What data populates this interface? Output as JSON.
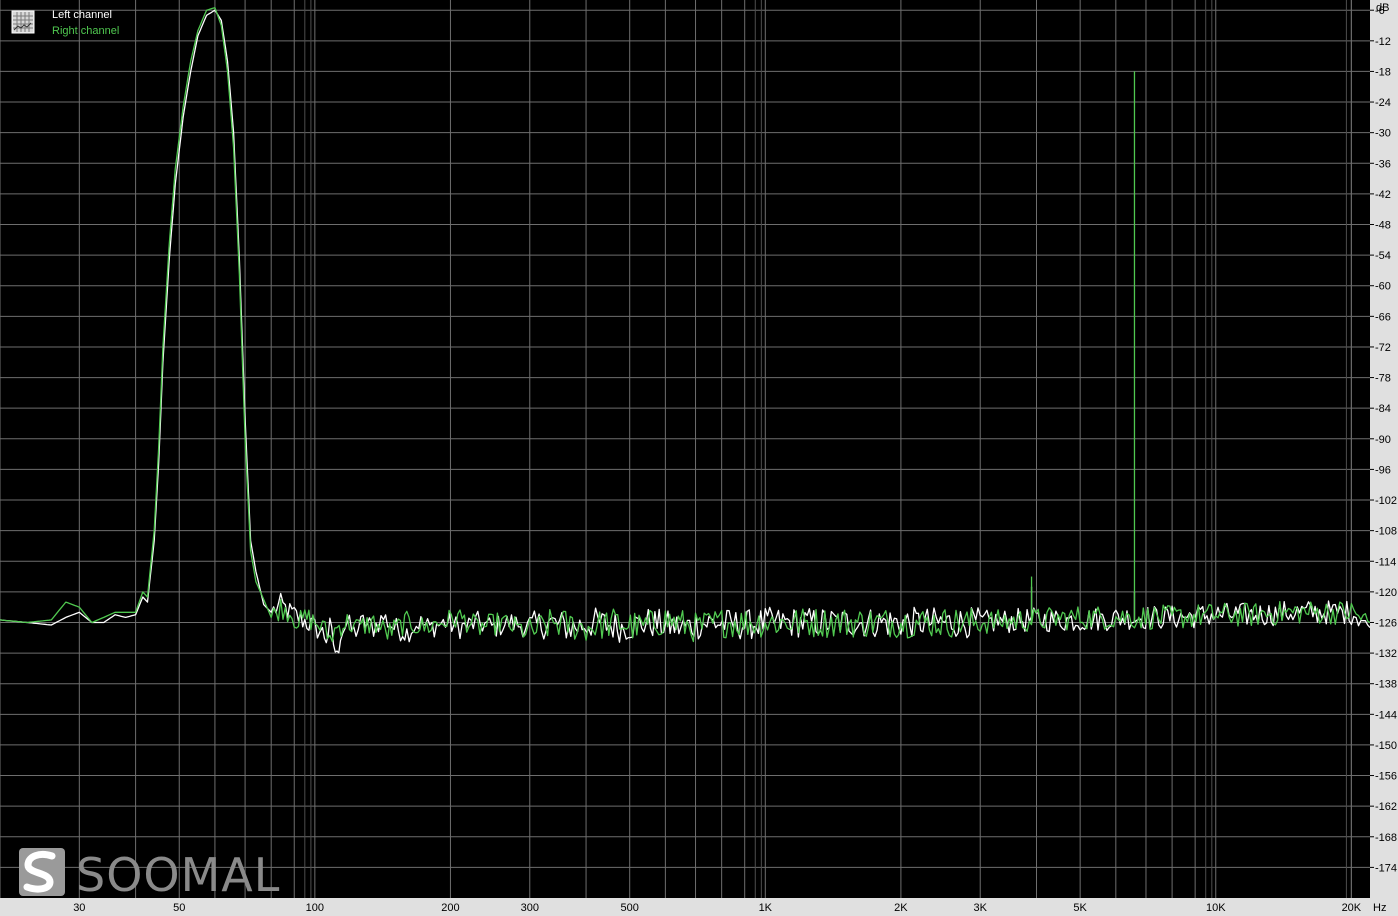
{
  "chart_data": {
    "type": "line",
    "x_unit": "Hz",
    "y_unit": "dB",
    "x_scale": "log",
    "xlim": [
      20,
      22000
    ],
    "ylim": [
      -180,
      -4
    ],
    "grid": true,
    "legend_placement": "top-left",
    "x_ticks": [
      {
        "value": 30,
        "label": "30"
      },
      {
        "value": 50,
        "label": "50"
      },
      {
        "value": 100,
        "label": "100"
      },
      {
        "value": 200,
        "label": "200"
      },
      {
        "value": 300,
        "label": "300"
      },
      {
        "value": 500,
        "label": "500"
      },
      {
        "value": 1000,
        "label": "1K"
      },
      {
        "value": 2000,
        "label": "2K"
      },
      {
        "value": 3000,
        "label": "3K"
      },
      {
        "value": 5000,
        "label": "5K"
      },
      {
        "value": 10000,
        "label": "10K"
      },
      {
        "value": 20000,
        "label": "20K"
      }
    ],
    "y_ticks": [
      {
        "value": -6,
        "label": "-6"
      },
      {
        "value": -12,
        "label": "-12"
      },
      {
        "value": -18,
        "label": "-18"
      },
      {
        "value": -24,
        "label": "-24"
      },
      {
        "value": -30,
        "label": "-30"
      },
      {
        "value": -36,
        "label": "-36"
      },
      {
        "value": -42,
        "label": "-42"
      },
      {
        "value": -48,
        "label": "-48"
      },
      {
        "value": -54,
        "label": "-54"
      },
      {
        "value": -60,
        "label": "-60"
      },
      {
        "value": -66,
        "label": "-66"
      },
      {
        "value": -72,
        "label": "-72"
      },
      {
        "value": -78,
        "label": "-78"
      },
      {
        "value": -84,
        "label": "-84"
      },
      {
        "value": -90,
        "label": "-90"
      },
      {
        "value": -96,
        "label": "-96"
      },
      {
        "value": -102,
        "label": "-102"
      },
      {
        "value": -108,
        "label": "-108"
      },
      {
        "value": -114,
        "label": "-114"
      },
      {
        "value": -120,
        "label": "-120"
      },
      {
        "value": -126,
        "label": "-126"
      },
      {
        "value": -132,
        "label": "-132"
      },
      {
        "value": -138,
        "label": "-138"
      },
      {
        "value": -144,
        "label": "-144"
      },
      {
        "value": -150,
        "label": "-150"
      },
      {
        "value": -156,
        "label": "-156"
      },
      {
        "value": -162,
        "label": "-162"
      },
      {
        "value": -168,
        "label": "-168"
      },
      {
        "value": -174,
        "label": "-174"
      }
    ],
    "series": [
      {
        "name": "Left channel",
        "color": "#ffffff",
        "points": [
          [
            20,
            -125.5
          ],
          [
            23,
            -126
          ],
          [
            26,
            -126.5
          ],
          [
            28,
            -125
          ],
          [
            30,
            -124
          ],
          [
            32,
            -126
          ],
          [
            34,
            -126
          ],
          [
            36,
            -124.5
          ],
          [
            38,
            -125
          ],
          [
            40,
            -124.5
          ],
          [
            41.5,
            -121
          ],
          [
            42.5,
            -122
          ],
          [
            44,
            -110
          ],
          [
            45,
            -95
          ],
          [
            46,
            -75
          ],
          [
            47.5,
            -55
          ],
          [
            49,
            -40
          ],
          [
            51,
            -27
          ],
          [
            53,
            -18
          ],
          [
            55,
            -11
          ],
          [
            57.5,
            -7
          ],
          [
            60,
            -6
          ],
          [
            62,
            -8
          ],
          [
            64,
            -16
          ],
          [
            66,
            -30
          ],
          [
            68,
            -55
          ],
          [
            70,
            -86
          ],
          [
            72,
            -110
          ],
          [
            74,
            -116
          ],
          [
            77,
            -122.5
          ],
          [
            80,
            -124
          ],
          [
            84,
            -122.5
          ],
          [
            88,
            -124
          ],
          [
            92,
            -125
          ],
          [
            96,
            -126
          ],
          [
            100,
            -127
          ],
          [
            104,
            -128
          ],
          [
            106,
            -129
          ],
          [
            108,
            -127
          ],
          [
            110,
            -130
          ],
          [
            112,
            -133
          ],
          [
            114,
            -128
          ],
          [
            118,
            -126
          ],
          [
            122,
            -128
          ],
          [
            128,
            -126
          ],
          [
            135,
            -127
          ],
          [
            142,
            -125
          ],
          [
            150,
            -127
          ],
          [
            160,
            -128
          ],
          [
            170,
            -126
          ],
          [
            180,
            -127
          ],
          [
            195,
            -126
          ],
          [
            210,
            -127
          ],
          [
            230,
            -126
          ],
          [
            250,
            -127
          ],
          [
            270,
            -126
          ],
          [
            300,
            -127
          ],
          [
            330,
            -126
          ],
          [
            370,
            -127
          ],
          [
            420,
            -126
          ],
          [
            480,
            -127
          ],
          [
            550,
            -126
          ],
          [
            650,
            -127
          ],
          [
            750,
            -126
          ],
          [
            900,
            -126.5
          ],
          [
            1000,
            -126
          ],
          [
            1500,
            -126
          ],
          [
            2000,
            -126
          ],
          [
            3000,
            -126
          ],
          [
            3900,
            -125.5
          ],
          [
            5000,
            -125.5
          ],
          [
            6500,
            -125
          ],
          [
            6600,
            -125
          ],
          [
            8000,
            -125
          ],
          [
            10000,
            -124.5
          ],
          [
            12000,
            -124.5
          ],
          [
            15000,
            -124
          ],
          [
            18000,
            -124
          ],
          [
            20000,
            -124
          ],
          [
            21000,
            -125
          ],
          [
            22000,
            -127
          ]
        ],
        "spikes": [
          [
            3900,
            -119
          ],
          [
            6600,
            -120
          ]
        ]
      },
      {
        "name": "Right channel",
        "color": "#50c850",
        "points": [
          [
            20,
            -125.5
          ],
          [
            23,
            -126
          ],
          [
            26,
            -125.5
          ],
          [
            28,
            -122
          ],
          [
            30,
            -123
          ],
          [
            32,
            -126
          ],
          [
            34,
            -125
          ],
          [
            36,
            -124
          ],
          [
            38,
            -124
          ],
          [
            40,
            -124
          ],
          [
            41.5,
            -120
          ],
          [
            42.5,
            -121
          ],
          [
            44,
            -108
          ],
          [
            45,
            -92
          ],
          [
            46,
            -72
          ],
          [
            47.5,
            -52
          ],
          [
            49,
            -37
          ],
          [
            51,
            -25
          ],
          [
            53,
            -16
          ],
          [
            55,
            -10
          ],
          [
            57.5,
            -6
          ],
          [
            60,
            -5.5
          ],
          [
            62,
            -9
          ],
          [
            64,
            -18
          ],
          [
            66,
            -33
          ],
          [
            68,
            -58
          ],
          [
            70,
            -90
          ],
          [
            72,
            -112
          ],
          [
            74,
            -118
          ],
          [
            77,
            -121.5
          ],
          [
            80,
            -125
          ],
          [
            84,
            -123
          ],
          [
            88,
            -124
          ],
          [
            92,
            -126
          ],
          [
            96,
            -125
          ],
          [
            100,
            -126
          ],
          [
            104,
            -127
          ],
          [
            108,
            -129
          ],
          [
            112,
            -127
          ],
          [
            118,
            -126
          ],
          [
            125,
            -127
          ],
          [
            135,
            -126
          ],
          [
            145,
            -128
          ],
          [
            160,
            -126
          ],
          [
            175,
            -127
          ],
          [
            190,
            -126
          ],
          [
            210,
            -125
          ],
          [
            230,
            -127
          ],
          [
            260,
            -126
          ],
          [
            300,
            -128
          ],
          [
            340,
            -126
          ],
          [
            400,
            -127
          ],
          [
            460,
            -126
          ],
          [
            530,
            -127
          ],
          [
            600,
            -125.5
          ],
          [
            700,
            -127
          ],
          [
            800,
            -126
          ],
          [
            1000,
            -126
          ],
          [
            1500,
            -126
          ],
          [
            2000,
            -126
          ],
          [
            3000,
            -126
          ],
          [
            3900,
            -125.5
          ],
          [
            5000,
            -125
          ],
          [
            6500,
            -125
          ],
          [
            6600,
            -125
          ],
          [
            8000,
            -125
          ],
          [
            10000,
            -124.5
          ],
          [
            12000,
            -124.5
          ],
          [
            15000,
            -124
          ],
          [
            18000,
            -124
          ],
          [
            20000,
            -124
          ],
          [
            21000,
            -125
          ],
          [
            22000,
            -126
          ]
        ],
        "spikes": [
          [
            3900,
            -117
          ],
          [
            6600,
            -18
          ]
        ]
      }
    ]
  },
  "legend": {
    "icon": "spectrum-icon",
    "items": [
      {
        "label": "Left channel",
        "color": "#ffffff"
      },
      {
        "label": "Right channel",
        "color": "#50c850"
      }
    ]
  },
  "watermark": {
    "logo": "soomal-logo-icon",
    "text": "SOOMAL"
  },
  "colors": {
    "background": "#000000",
    "grid": "#6e6e6e",
    "axis_panel": "#e0e0e0",
    "tick_text": "#000000"
  }
}
